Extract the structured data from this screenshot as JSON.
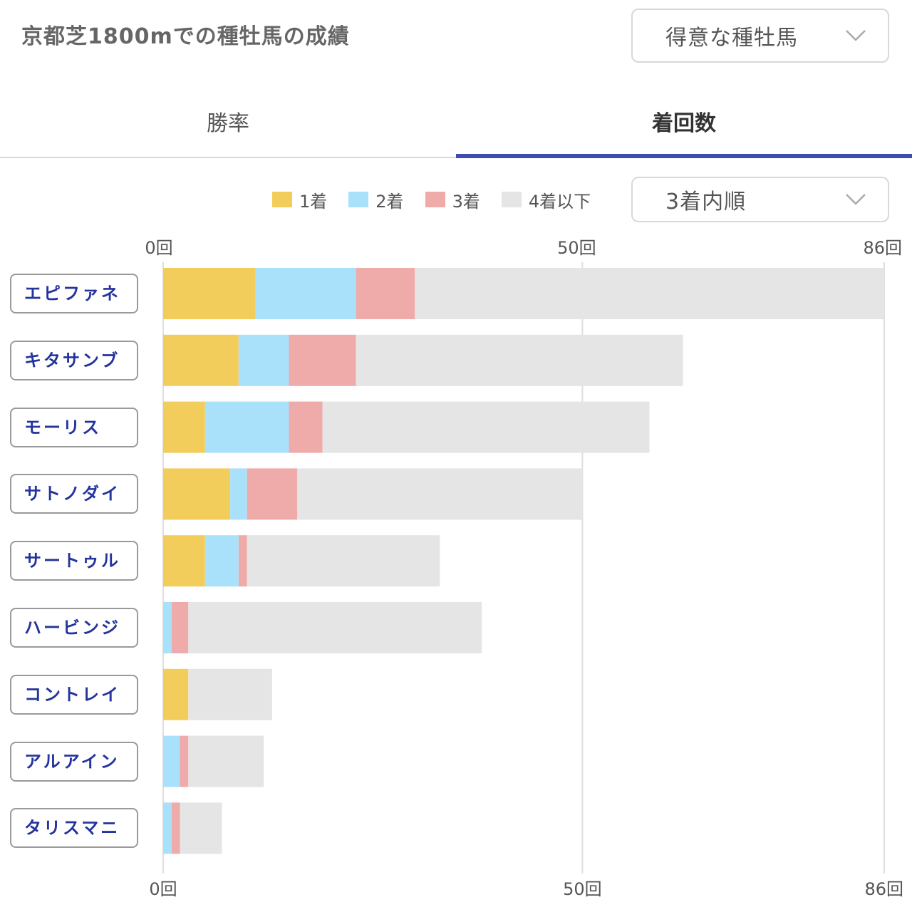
{
  "header": {
    "title": "京都芝1800mでの種牡馬の成績",
    "sort_select": "得意な種牡馬"
  },
  "tabs": [
    {
      "label": "勝率",
      "active": false
    },
    {
      "label": "着回数",
      "active": true
    }
  ],
  "order_select": "3着内順",
  "colors": {
    "first": "#f3cd5b",
    "second": "#a9e1fb",
    "third": "#efaaaa",
    "fourth_or_lower": "#e5e5e5",
    "accent": "#3f4db3",
    "name_text": "#24349c"
  },
  "chart_data": {
    "type": "bar",
    "orientation": "horizontal",
    "stacked": true,
    "xlim": [
      0,
      86
    ],
    "ticks": [
      {
        "value": 0,
        "label": "0回"
      },
      {
        "value": 50,
        "label": "50回"
      },
      {
        "value": 86,
        "label": "86回"
      }
    ],
    "legend_position": "top-right",
    "grid": true,
    "categories": [
      "エピファネ",
      "キタサンブ",
      "モーリス",
      "サトノダイ",
      "サートゥル",
      "ハービンジ",
      "コントレイ",
      "アルアイン",
      "タリスマニ"
    ],
    "series": [
      {
        "name": "1着",
        "values": [
          11,
          9,
          5,
          8,
          5,
          0,
          3,
          0,
          0
        ]
      },
      {
        "name": "2着",
        "values": [
          12,
          6,
          10,
          2,
          4,
          1,
          0,
          2,
          1
        ]
      },
      {
        "name": "3着",
        "values": [
          7,
          8,
          4,
          6,
          1,
          2,
          0,
          1,
          1
        ]
      },
      {
        "name": "4着以下",
        "values": [
          56,
          39,
          39,
          34,
          23,
          35,
          10,
          9,
          5
        ]
      }
    ]
  }
}
